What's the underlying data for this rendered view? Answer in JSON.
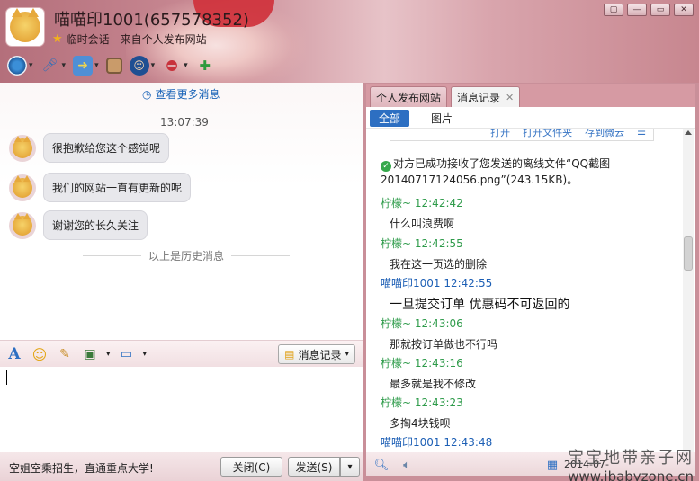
{
  "header": {
    "title": "喵喵印1001(657578352)",
    "subtitle": "临时会话 - 来自个人发布网站",
    "window_buttons": [
      "▢",
      "—",
      "▭",
      "✕"
    ]
  },
  "chat": {
    "more_messages": "查看更多消息",
    "time": "13:07:39",
    "messages": [
      "很抱歉给您这个感觉呢",
      "我们的网站一直有更新的呢",
      "谢谢您的长久关注"
    ],
    "history_label": "以上是历史消息"
  },
  "input_toolbar": {
    "message_record_label": "消息记录"
  },
  "bottom_bar": {
    "ad_text": "空姐空乘招生，直通重点大学!",
    "close_label": "关闭(C)",
    "send_label": "发送(S)"
  },
  "right_pane": {
    "tabs": [
      {
        "label": "个人发布网站"
      },
      {
        "label": "消息记录"
      }
    ],
    "filters": [
      "全部",
      "图片"
    ],
    "file_actions": [
      "打开",
      "打开文件夹",
      "存到微云",
      "☰"
    ],
    "system_message": "对方已成功接收了您发送的离线文件“QQ截图20140717124056.png”(243.15KB)。",
    "log": [
      {
        "sender": "柠檬~ 12:42:42",
        "text": "什么叫浪费啊",
        "sender_color": "green",
        "size": "normal"
      },
      {
        "sender": "柠檬~ 12:42:55",
        "text": "我在这一页选的删除",
        "sender_color": "green",
        "size": "normal"
      },
      {
        "sender": "喵喵印1001 12:42:55",
        "text": "一旦提交订单 优惠码不可返回的",
        "sender_color": "blue",
        "size": "big"
      },
      {
        "sender": "柠檬~ 12:43:06",
        "text": "那就按订单做也不行吗",
        "sender_color": "green",
        "size": "normal"
      },
      {
        "sender": "柠檬~ 12:43:16",
        "text": "最多就是我不修改",
        "sender_color": "green",
        "size": "normal"
      },
      {
        "sender": "柠檬~ 12:43:23",
        "text": "多掏4块钱呗",
        "sender_color": "green",
        "size": "normal"
      },
      {
        "sender": "喵喵印1001 12:43:48",
        "text": "",
        "sender_color": "blue",
        "size": "normal"
      }
    ],
    "bottom_date": "2014-07-"
  },
  "watermark": {
    "line1": "宝宝地带亲子网",
    "line2": "www.ibabyzone.cn"
  },
  "colors": {
    "accent_blue": "#2d6fc2",
    "sender_green": "#2e9b4a",
    "sender_blue": "#1d5fb5",
    "frame_pink": "#c98f99"
  },
  "icons": [
    "avatar-cat-icon",
    "star-icon",
    "camera-icon",
    "microphone-icon",
    "folder-transfer-icon",
    "screen-share-icon",
    "police-avatar-icon",
    "block-user-icon",
    "add-user-icon",
    "clock-icon",
    "font-icon",
    "emoji-icon",
    "scissors-icon",
    "image-icon",
    "screenshot-icon",
    "record-icon",
    "search-icon",
    "speaker-icon",
    "calendar-icon"
  ]
}
